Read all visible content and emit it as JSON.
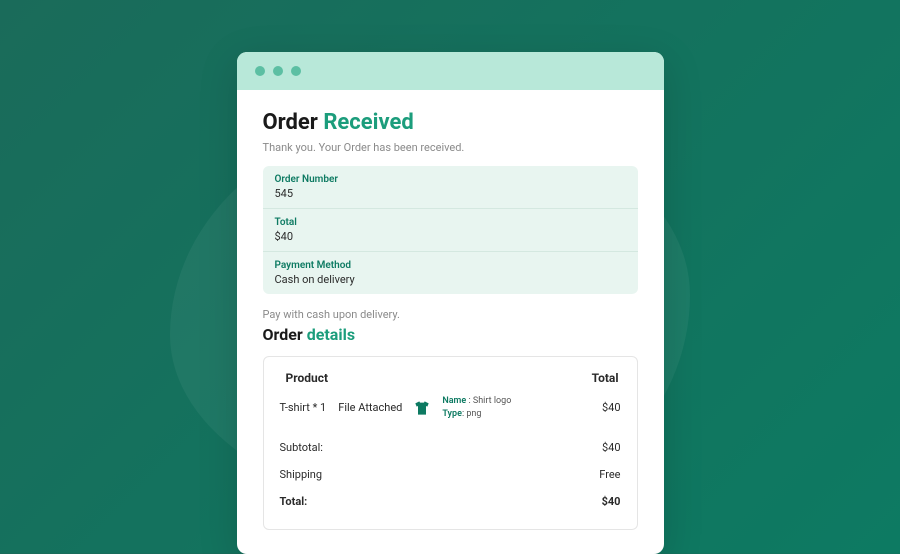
{
  "header": {
    "title_prefix": "Order ",
    "title_accent": "Received",
    "thankyou": "Thank you. Your Order has been received."
  },
  "summary": {
    "order_number_label": "Order Number",
    "order_number_value": "545",
    "total_label": "Total",
    "total_value": "$40",
    "payment_label": "Payment Method",
    "payment_value": "Cash on delivery"
  },
  "pay_note": "Pay with cash upon delivery.",
  "details": {
    "title_prefix": "Order ",
    "title_accent": "details",
    "col_product": "Product",
    "col_total": "Total",
    "product": {
      "name_qty": "T-shirt * 1",
      "file_attached": "File Attached",
      "meta_name_label": "Name",
      "meta_name_value": " : Shirt logo",
      "meta_type_label": "Type",
      "meta_type_value": ": png",
      "price": "$40"
    },
    "subtotal_label": "Subtotal:",
    "subtotal_value": "$40",
    "shipping_label": "Shipping",
    "shipping_value": "Free",
    "total_label": "Total:",
    "total_value": "$40"
  }
}
